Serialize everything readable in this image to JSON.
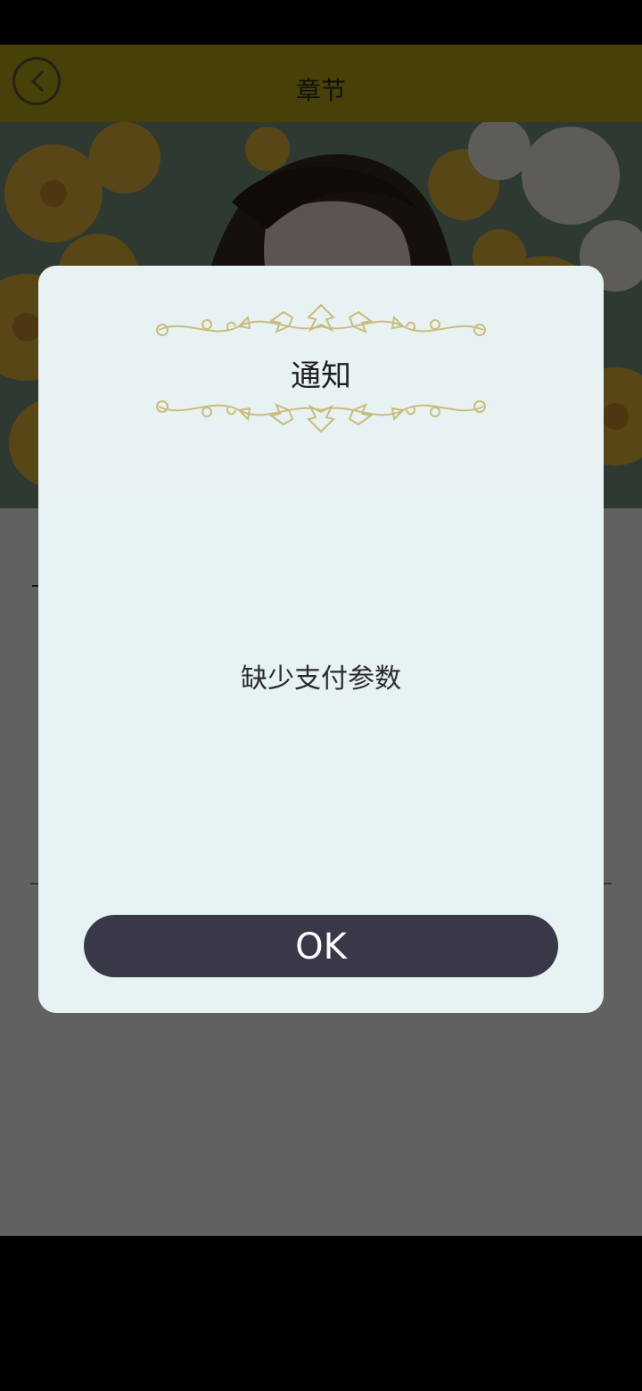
{
  "header": {
    "title": "章节",
    "back_icon": "chevron-left-icon"
  },
  "content": {
    "line1": "",
    "line3": ""
  },
  "dialog": {
    "title": "通知",
    "message": "缺少支付参数",
    "ok_label": "OK"
  },
  "colors": {
    "header_bg": "#bcaa19",
    "dialog_bg": "#e7f2f2",
    "button_bg": "#383848",
    "ornament": "#c9bd7d"
  }
}
